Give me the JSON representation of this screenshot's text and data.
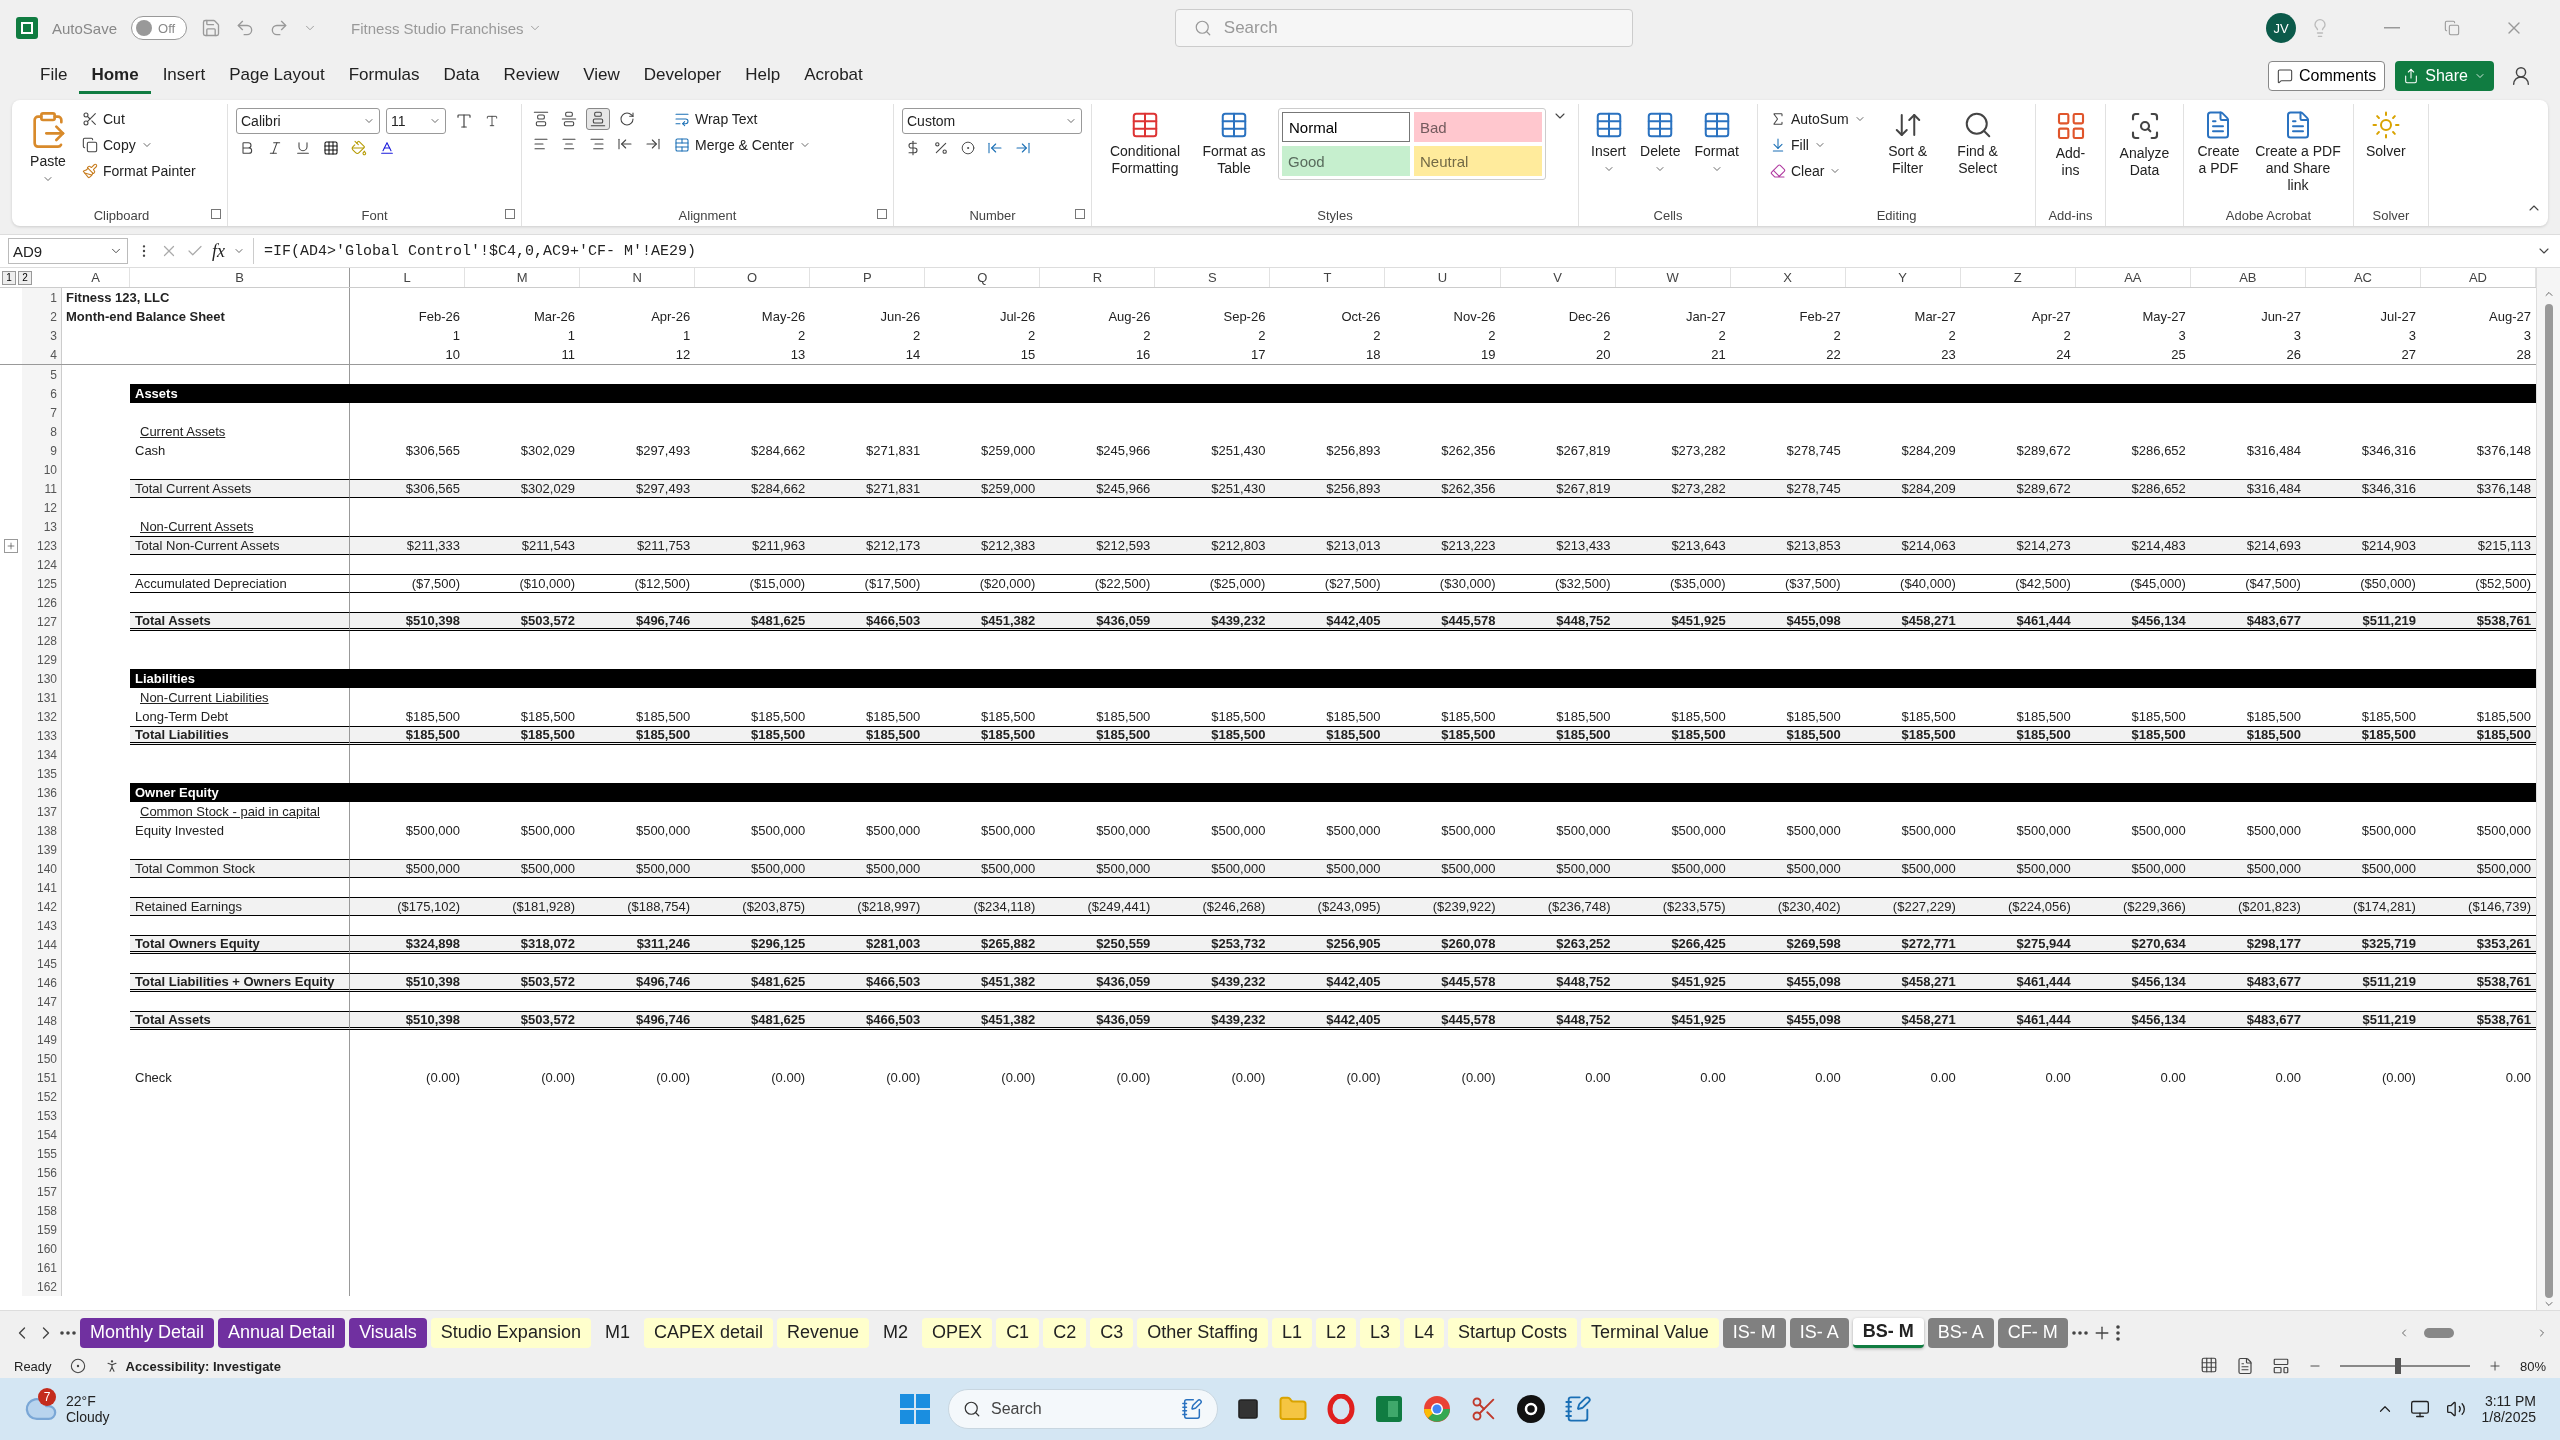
{
  "title_bar": {
    "autosave": "AutoSave",
    "autosave_on": false,
    "toggle_text": "Off",
    "document": "Fitness Studio Franchises",
    "search": "Search",
    "user": "JV"
  },
  "menu_tabs": [
    {
      "label": "File",
      "selected": false
    },
    {
      "label": "Home",
      "selected": true
    },
    {
      "label": "Insert",
      "selected": false
    },
    {
      "label": "Page Layout",
      "selected": false
    },
    {
      "label": "Formulas",
      "selected": false
    },
    {
      "label": "Data",
      "selected": false
    },
    {
      "label": "Review",
      "selected": false
    },
    {
      "label": "View",
      "selected": false
    },
    {
      "label": "Developer",
      "selected": false
    },
    {
      "label": "Help",
      "selected": false
    },
    {
      "label": "Acrobat",
      "selected": false
    }
  ],
  "comments": "Comments",
  "share": "Share",
  "ribbon": {
    "clipboard": {
      "label": "Clipboard",
      "paste": "Paste",
      "cut": "Cut",
      "copy": "Copy",
      "format_painter": "Format Painter"
    },
    "font": {
      "label": "Font",
      "name": "Calibri",
      "size": "11"
    },
    "alignment": {
      "label": "Alignment",
      "wrap_text": "Wrap Text",
      "merge": "Merge & Center"
    },
    "number": {
      "label": "Number",
      "format": "Custom"
    },
    "styles": {
      "label": "Styles",
      "conditional": "Conditional Formatting",
      "format_table": "Format as Table",
      "cell_styles": [
        {
          "label": "Normal",
          "color": "#ffffff"
        },
        {
          "label": "Bad",
          "color": "#ffc7ce"
        },
        {
          "label": "Good",
          "color": "#c6efce"
        },
        {
          "label": "Neutral",
          "color": "#ffeb9c"
        }
      ]
    },
    "cells": {
      "label": "Cells",
      "buttons": [
        "Insert",
        "Delete",
        "Format"
      ]
    },
    "editing": {
      "label": "Editing",
      "autosum": "AutoSum",
      "fill": "Fill",
      "clear": "Clear",
      "sort": "Sort & Filter",
      "find": "Find & Select"
    },
    "addins": {
      "label": "Add-ins",
      "button": "Add-ins"
    },
    "analyze": {
      "button": "Analyze Data"
    },
    "acrobat": {
      "label": "Adobe Acrobat",
      "buttons": [
        "Create a PDF",
        "Create a PDF and Share link"
      ]
    },
    "solver": {
      "label": "Solver",
      "button": "Solver"
    }
  },
  "formula_bar": {
    "name_box": "AD9",
    "fx": "fx",
    "formula": "=IF(AD4>'Global Control'!$C4,0,AC9+'CF- M'!AE29)"
  },
  "outline_levels": [
    "1",
    "2"
  ],
  "columns": [
    "A",
    "B",
    "L",
    "M",
    "N",
    "O",
    "P",
    "Q",
    "R",
    "S",
    "T",
    "U",
    "V",
    "W",
    "X",
    "Y",
    "Z",
    "AA",
    "AB",
    "AC",
    "AD"
  ],
  "frozen_rows": [
    {
      "num": "1",
      "title": "Fitness 123, LLC"
    },
    {
      "num": "2",
      "title": "Month-end Balance Sheet",
      "values": [
        "Feb-26",
        "Mar-26",
        "Apr-26",
        "May-26",
        "Jun-26",
        "Jul-26",
        "Aug-26",
        "Sep-26",
        "Oct-26",
        "Nov-26",
        "Dec-26",
        "Jan-27",
        "Feb-27",
        "Mar-27",
        "Apr-27",
        "May-27",
        "Jun-27",
        "Jul-27",
        "Aug-27"
      ]
    },
    {
      "num": "3",
      "values": [
        "1",
        "1",
        "1",
        "2",
        "2",
        "2",
        "2",
        "2",
        "2",
        "2",
        "2",
        "2",
        "2",
        "2",
        "2",
        "3",
        "3",
        "3",
        "3"
      ]
    },
    {
      "num": "4",
      "values": [
        "10",
        "11",
        "12",
        "13",
        "14",
        "15",
        "16",
        "17",
        "18",
        "19",
        "20",
        "21",
        "22",
        "23",
        "24",
        "25",
        "26",
        "27",
        "28"
      ]
    }
  ],
  "rows": [
    {
      "num": "5"
    },
    {
      "num": "6",
      "kind": "section",
      "label": "Assets"
    },
    {
      "num": "7"
    },
    {
      "num": "8",
      "kind": "subhead",
      "label": "Current Assets"
    },
    {
      "num": "9",
      "kind": "item",
      "label": "Cash",
      "values": [
        "$306,565",
        "$302,029",
        "$297,493",
        "$284,662",
        "$271,831",
        "$259,000",
        "$245,966",
        "$251,430",
        "$256,893",
        "$262,356",
        "$267,819",
        "$273,282",
        "$278,745",
        "$284,209",
        "$289,672",
        "$286,652",
        "$316,484",
        "$346,316",
        "$376,148"
      ]
    },
    {
      "num": "10"
    },
    {
      "num": "11",
      "kind": "total",
      "label": "Total Current Assets",
      "values": [
        "$306,565",
        "$302,029",
        "$297,493",
        "$284,662",
        "$271,831",
        "$259,000",
        "$245,966",
        "$251,430",
        "$256,893",
        "$262,356",
        "$267,819",
        "$273,282",
        "$278,745",
        "$284,209",
        "$289,672",
        "$286,652",
        "$316,484",
        "$346,316",
        "$376,148"
      ]
    },
    {
      "num": "12"
    },
    {
      "num": "13",
      "kind": "subhead",
      "label": "Non-Current Assets"
    },
    {
      "num": "123",
      "kind": "total",
      "label": "Total Non-Current Assets",
      "collapsed": true,
      "values": [
        "$211,333",
        "$211,543",
        "$211,753",
        "$211,963",
        "$212,173",
        "$212,383",
        "$212,593",
        "$212,803",
        "$213,013",
        "$213,223",
        "$213,433",
        "$213,643",
        "$213,853",
        "$214,063",
        "$214,273",
        "$214,483",
        "$214,693",
        "$214,903",
        "$215,113"
      ]
    },
    {
      "num": "124"
    },
    {
      "num": "125",
      "kind": "boxed",
      "label": "Accumulated Depreciation",
      "values": [
        "($7,500)",
        "($10,000)",
        "($12,500)",
        "($15,000)",
        "($17,500)",
        "($20,000)",
        "($22,500)",
        "($25,000)",
        "($27,500)",
        "($30,000)",
        "($32,500)",
        "($35,000)",
        "($37,500)",
        "($40,000)",
        "($42,500)",
        "($45,000)",
        "($47,500)",
        "($50,000)",
        "($52,500)"
      ]
    },
    {
      "num": "126"
    },
    {
      "num": "127",
      "kind": "grand",
      "label": "Total Assets",
      "values": [
        "$510,398",
        "$503,572",
        "$496,746",
        "$481,625",
        "$466,503",
        "$451,382",
        "$436,059",
        "$439,232",
        "$442,405",
        "$445,578",
        "$448,752",
        "$451,925",
        "$455,098",
        "$458,271",
        "$461,444",
        "$456,134",
        "$483,677",
        "$511,219",
        "$538,761"
      ]
    },
    {
      "num": "128"
    },
    {
      "num": "129"
    },
    {
      "num": "130",
      "kind": "section",
      "label": "Liabilities"
    },
    {
      "num": "131",
      "kind": "subhead",
      "label": "Non-Current Liabilities"
    },
    {
      "num": "132",
      "kind": "item",
      "label": "Long-Term Debt",
      "values": [
        "$185,500",
        "$185,500",
        "$185,500",
        "$185,500",
        "$185,500",
        "$185,500",
        "$185,500",
        "$185,500",
        "$185,500",
        "$185,500",
        "$185,500",
        "$185,500",
        "$185,500",
        "$185,500",
        "$185,500",
        "$185,500",
        "$185,500",
        "$185,500",
        "$185,500"
      ]
    },
    {
      "num": "133",
      "kind": "grand",
      "label": "Total Liabilities",
      "values": [
        "$185,500",
        "$185,500",
        "$185,500",
        "$185,500",
        "$185,500",
        "$185,500",
        "$185,500",
        "$185,500",
        "$185,500",
        "$185,500",
        "$185,500",
        "$185,500",
        "$185,500",
        "$185,500",
        "$185,500",
        "$185,500",
        "$185,500",
        "$185,500",
        "$185,500"
      ]
    },
    {
      "num": "134"
    },
    {
      "num": "135"
    },
    {
      "num": "136",
      "kind": "section",
      "label": "Owner Equity"
    },
    {
      "num": "137",
      "kind": "subhead",
      "label": "Common Stock - paid in capital"
    },
    {
      "num": "138",
      "kind": "item",
      "label": "Equity Invested",
      "values": [
        "$500,000",
        "$500,000",
        "$500,000",
        "$500,000",
        "$500,000",
        "$500,000",
        "$500,000",
        "$500,000",
        "$500,000",
        "$500,000",
        "$500,000",
        "$500,000",
        "$500,000",
        "$500,000",
        "$500,000",
        "$500,000",
        "$500,000",
        "$500,000",
        "$500,000"
      ]
    },
    {
      "num": "139"
    },
    {
      "num": "140",
      "kind": "total",
      "label": "Total Common Stock",
      "values": [
        "$500,000",
        "$500,000",
        "$500,000",
        "$500,000",
        "$500,000",
        "$500,000",
        "$500,000",
        "$500,000",
        "$500,000",
        "$500,000",
        "$500,000",
        "$500,000",
        "$500,000",
        "$500,000",
        "$500,000",
        "$500,000",
        "$500,000",
        "$500,000",
        "$500,000"
      ]
    },
    {
      "num": "141"
    },
    {
      "num": "142",
      "kind": "total",
      "label": "Retained Earnings",
      "values": [
        "($175,102)",
        "($181,928)",
        "($188,754)",
        "($203,875)",
        "($218,997)",
        "($234,118)",
        "($249,441)",
        "($246,268)",
        "($243,095)",
        "($239,922)",
        "($236,748)",
        "($233,575)",
        "($230,402)",
        "($227,229)",
        "($224,056)",
        "($229,366)",
        "($201,823)",
        "($174,281)",
        "($146,739)"
      ]
    },
    {
      "num": "143"
    },
    {
      "num": "144",
      "kind": "grand",
      "label": "Total Owners Equity",
      "values": [
        "$324,898",
        "$318,072",
        "$311,246",
        "$296,125",
        "$281,003",
        "$265,882",
        "$250,559",
        "$253,732",
        "$256,905",
        "$260,078",
        "$263,252",
        "$266,425",
        "$269,598",
        "$272,771",
        "$275,944",
        "$270,634",
        "$298,177",
        "$325,719",
        "$353,261"
      ]
    },
    {
      "num": "145"
    },
    {
      "num": "146",
      "kind": "grand",
      "label": "Total Liabilities + Owners Equity",
      "values": [
        "$510,398",
        "$503,572",
        "$496,746",
        "$481,625",
        "$466,503",
        "$451,382",
        "$436,059",
        "$439,232",
        "$442,405",
        "$445,578",
        "$448,752",
        "$451,925",
        "$455,098",
        "$458,271",
        "$461,444",
        "$456,134",
        "$483,677",
        "$511,219",
        "$538,761"
      ]
    },
    {
      "num": "147"
    },
    {
      "num": "148",
      "kind": "grand",
      "label": "Total Assets",
      "values": [
        "$510,398",
        "$503,572",
        "$496,746",
        "$481,625",
        "$466,503",
        "$451,382",
        "$436,059",
        "$439,232",
        "$442,405",
        "$445,578",
        "$448,752",
        "$451,925",
        "$455,098",
        "$458,271",
        "$461,444",
        "$456,134",
        "$483,677",
        "$511,219",
        "$538,761"
      ]
    },
    {
      "num": "149"
    },
    {
      "num": "150"
    },
    {
      "num": "151",
      "kind": "item",
      "label": "Check",
      "values": [
        "(0.00)",
        "(0.00)",
        "(0.00)",
        "(0.00)",
        "(0.00)",
        "(0.00)",
        "(0.00)",
        "(0.00)",
        "(0.00)",
        "(0.00)",
        "0.00",
        "0.00",
        "0.00",
        "0.00",
        "0.00",
        "0.00",
        "0.00",
        "(0.00)",
        "0.00"
      ]
    },
    {
      "num": "152"
    },
    {
      "num": "153"
    },
    {
      "num": "154"
    },
    {
      "num": "155"
    },
    {
      "num": "156"
    },
    {
      "num": "157"
    },
    {
      "num": "158"
    },
    {
      "num": "159"
    },
    {
      "num": "160"
    },
    {
      "num": "161"
    },
    {
      "num": "162"
    }
  ],
  "sheet_tabs": [
    {
      "label": "Monthly Detail",
      "color": "#7030a0",
      "selected": false
    },
    {
      "label": "Annual Detail",
      "color": "#7030a0",
      "selected": false
    },
    {
      "label": "Visuals",
      "color": "#7030a0",
      "selected": false
    },
    {
      "label": "Studio Expansion",
      "color": "#ffffcc",
      "selected": false
    },
    {
      "label": "M1",
      "selected": false
    },
    {
      "label": "CAPEX detail",
      "color": "#ffffcc",
      "selected": false
    },
    {
      "label": "Revenue",
      "color": "#ffffcc",
      "selected": false
    },
    {
      "label": "M2",
      "selected": false
    },
    {
      "label": "OPEX",
      "color": "#ffffcc",
      "selected": false
    },
    {
      "label": "C1",
      "color": "#ffffcc",
      "selected": false
    },
    {
      "label": "C2",
      "color": "#ffffcc",
      "selected": false
    },
    {
      "label": "C3",
      "color": "#ffffcc",
      "selected": false
    },
    {
      "label": "Other Staffing",
      "color": "#ffffcc",
      "selected": false
    },
    {
      "label": "L1",
      "color": "#ffffcc",
      "selected": false
    },
    {
      "label": "L2",
      "color": "#ffffcc",
      "selected": false
    },
    {
      "label": "L3",
      "color": "#ffffcc",
      "selected": false
    },
    {
      "label": "L4",
      "color": "#ffffcc",
      "selected": false
    },
    {
      "label": "Startup Costs",
      "color": "#ffffcc",
      "selected": false
    },
    {
      "label": "Terminal Value",
      "color": "#ffffcc",
      "selected": false
    },
    {
      "label": "IS- M",
      "color": "#808080",
      "selected": false
    },
    {
      "label": "IS- A",
      "color": "#808080",
      "selected": false
    },
    {
      "label": "BS- M",
      "selected": true
    },
    {
      "label": "BS- A",
      "color": "#808080",
      "selected": false
    },
    {
      "label": "CF- M",
      "color": "#808080",
      "selected": false
    }
  ],
  "status_bar": {
    "ready": "Ready",
    "accessibility": "Accessibility: Investigate",
    "zoom": "80%",
    "zoom_slider": {
      "level": 0.42
    }
  },
  "taskbar": {
    "badge": "7",
    "temperature": "22°F",
    "weather": "Cloudy",
    "search": "Search",
    "time": "3:11 PM",
    "date": "1/8/2025"
  }
}
